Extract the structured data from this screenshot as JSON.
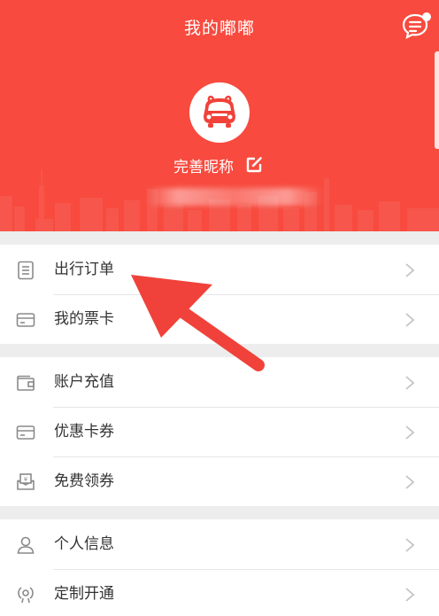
{
  "header": {
    "title": "我的嘟嘟",
    "nickname": "完善昵称",
    "background_color": "#f84a3e"
  },
  "icons": {
    "message": "chat-bubble-icon",
    "avatar": "bus-mascot-icon",
    "edit": "edit-icon",
    "chevron": "chevron-right-icon"
  },
  "menu": {
    "group1": [
      {
        "label": "出行订单",
        "icon": "order-list-icon"
      },
      {
        "label": "我的票卡",
        "icon": "ticket-card-icon"
      }
    ],
    "group2": [
      {
        "label": "账户充值",
        "icon": "wallet-icon"
      },
      {
        "label": "优惠卡券",
        "icon": "coupon-card-icon"
      },
      {
        "label": "免费领券",
        "icon": "free-coupon-icon"
      }
    ],
    "group3": [
      {
        "label": "个人信息",
        "icon": "person-icon"
      },
      {
        "label": "定制开通",
        "icon": "custom-route-icon"
      }
    ]
  },
  "annotation": {
    "arrow_color": "#f0423a"
  }
}
